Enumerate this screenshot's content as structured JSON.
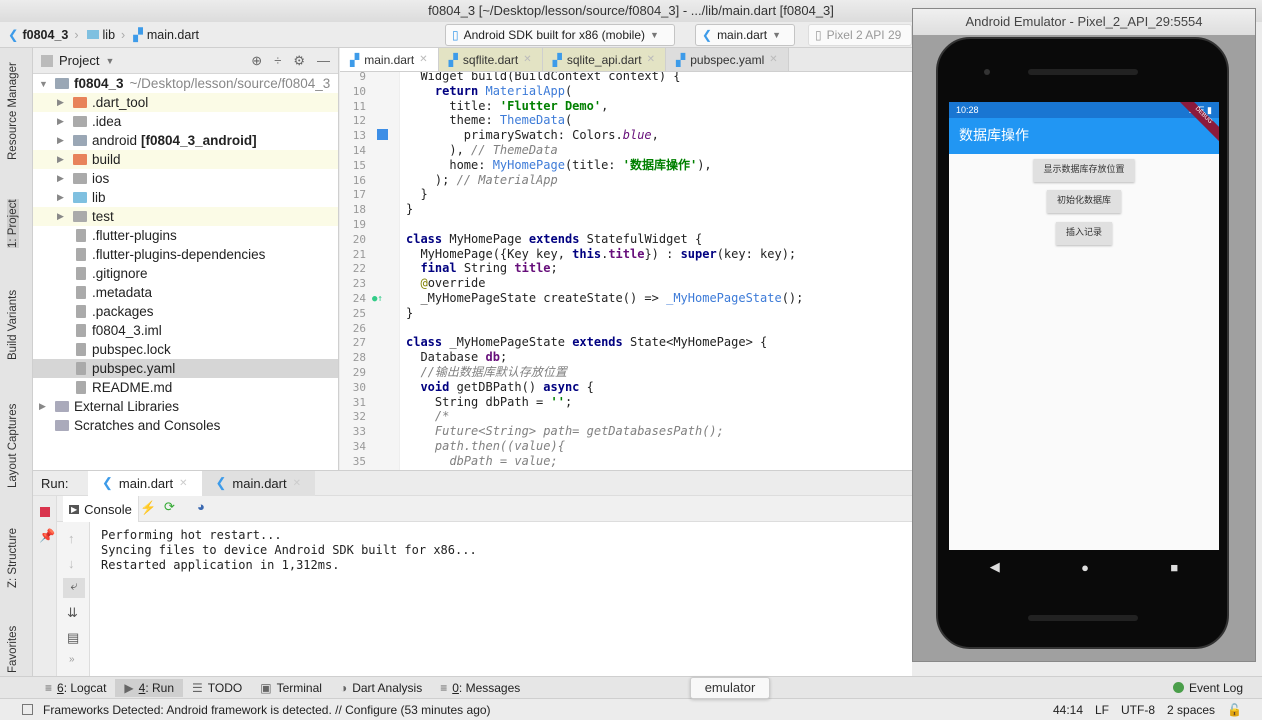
{
  "window_title": "f0804_3 [~/Desktop/lesson/source/f0804_3] - .../lib/main.dart [f0804_3]",
  "nav": {
    "breadcrumbs": [
      "f0804_3",
      "lib",
      "main.dart"
    ],
    "device_selector": "Android SDK built for x86 (mobile)",
    "run_config": "main.dart",
    "avd": "Pixel 2 API 29"
  },
  "left_stripe": [
    "Resource Manager",
    "1: Project",
    "Build Variants",
    "Layout Captures",
    "Z: Structure",
    "Favorites"
  ],
  "project": {
    "header": "Project",
    "root": "f0804_3",
    "root_path": "~/Desktop/lesson/source/f0804_3",
    "items": [
      {
        "label": ".dart_tool",
        "type": "folder",
        "color": "#e8835a"
      },
      {
        "label": ".idea",
        "type": "folder",
        "color": "#aaaaaa"
      },
      {
        "label": "android",
        "suffix": "[f0804_3_android]",
        "type": "folder",
        "color": "#9aa7b5"
      },
      {
        "label": "build",
        "type": "folder",
        "color": "#e8835a"
      },
      {
        "label": "ios",
        "type": "folder",
        "color": "#aaaaaa"
      },
      {
        "label": "lib",
        "type": "folder",
        "color": "#7fc0e0"
      },
      {
        "label": "test",
        "type": "folder",
        "color": "#aaaaaa"
      },
      {
        "label": ".flutter-plugins",
        "type": "file"
      },
      {
        "label": ".flutter-plugins-dependencies",
        "type": "file"
      },
      {
        "label": ".gitignore",
        "type": "file"
      },
      {
        "label": ".metadata",
        "type": "file"
      },
      {
        "label": ".packages",
        "type": "file"
      },
      {
        "label": "f0804_3.iml",
        "type": "file"
      },
      {
        "label": "pubspec.lock",
        "type": "file"
      },
      {
        "label": "pubspec.yaml",
        "type": "file",
        "selected": true
      },
      {
        "label": "README.md",
        "type": "file"
      }
    ],
    "external_libraries": "External Libraries",
    "scratches": "Scratches and Consoles"
  },
  "editor": {
    "tabs": [
      "main.dart",
      "sqflite.dart",
      "sqlite_api.dart",
      "pubspec.yaml"
    ],
    "active_tab": 0,
    "lines": [
      {
        "n": "9",
        "t": [
          [
            "  Widget build(BuildContext context) {",
            ""
          ]
        ]
      },
      {
        "n": "10",
        "t": [
          [
            "    ",
            ""
          ],
          [
            "return ",
            "kw"
          ],
          [
            "MaterialApp",
            "cls"
          ],
          [
            "(",
            ""
          ]
        ]
      },
      {
        "n": "11",
        "t": [
          [
            "      title: ",
            ""
          ],
          [
            "'Flutter Demo'",
            "str"
          ],
          [
            ",",
            ""
          ]
        ]
      },
      {
        "n": "12",
        "t": [
          [
            "      theme: ",
            ""
          ],
          [
            "ThemeData",
            "cls"
          ],
          [
            "(",
            ""
          ]
        ]
      },
      {
        "n": "13",
        "t": [
          [
            "        primarySwatch: Colors.",
            ""
          ],
          [
            "blue",
            "it"
          ],
          [
            ",",
            ""
          ]
        ]
      },
      {
        "n": "14",
        "t": [
          [
            "      ), ",
            ""
          ],
          [
            "// ThemeData",
            "cm"
          ]
        ]
      },
      {
        "n": "15",
        "t": [
          [
            "      home: ",
            ""
          ],
          [
            "MyHomePage",
            "cls"
          ],
          [
            "(title: ",
            ""
          ],
          [
            "'数据库操作'",
            "str"
          ],
          [
            "),",
            ""
          ]
        ]
      },
      {
        "n": "16",
        "t": [
          [
            "    ); ",
            ""
          ],
          [
            "// MaterialApp",
            "cm"
          ]
        ]
      },
      {
        "n": "17",
        "t": [
          [
            "  }",
            ""
          ]
        ]
      },
      {
        "n": "18",
        "t": [
          [
            "}",
            ""
          ]
        ]
      },
      {
        "n": "19",
        "t": [
          [
            "",
            ""
          ]
        ]
      },
      {
        "n": "20",
        "t": [
          [
            "class ",
            "kw"
          ],
          [
            "MyHomePage ",
            ""
          ],
          [
            "extends ",
            "kw"
          ],
          [
            "StatefulWidget {",
            ""
          ]
        ]
      },
      {
        "n": "21",
        "t": [
          [
            "  MyHomePage({Key key, ",
            ""
          ],
          [
            "this",
            "kw"
          ],
          [
            ".",
            ""
          ],
          [
            "title",
            "fld"
          ],
          [
            "}) : ",
            ""
          ],
          [
            "super",
            "kw"
          ],
          [
            "(key: key);",
            ""
          ]
        ]
      },
      {
        "n": "22",
        "t": [
          [
            "  ",
            ""
          ],
          [
            "final ",
            "kw"
          ],
          [
            "String ",
            ""
          ],
          [
            "title",
            "fld"
          ],
          [
            ";",
            ""
          ]
        ]
      },
      {
        "n": "23",
        "t": [
          [
            "  ",
            ""
          ],
          [
            "@",
            "ann"
          ],
          [
            "override",
            ""
          ]
        ]
      },
      {
        "n": "24",
        "t": [
          [
            "  _MyHomePageState createState() => ",
            ""
          ],
          [
            "_MyHomePageState",
            "cls"
          ],
          [
            "();",
            ""
          ]
        ]
      },
      {
        "n": "25",
        "t": [
          [
            "}",
            ""
          ]
        ]
      },
      {
        "n": "26",
        "t": [
          [
            "",
            ""
          ]
        ]
      },
      {
        "n": "27",
        "t": [
          [
            "class ",
            "kw"
          ],
          [
            "_MyHomePageState ",
            ""
          ],
          [
            "extends ",
            "kw"
          ],
          [
            "State<MyHomePage> {",
            ""
          ]
        ]
      },
      {
        "n": "28",
        "t": [
          [
            "  Database ",
            ""
          ],
          [
            "db",
            "fld"
          ],
          [
            ";",
            ""
          ]
        ]
      },
      {
        "n": "29",
        "t": [
          [
            "  //输出数据库默认存放位置",
            "cm"
          ]
        ]
      },
      {
        "n": "30",
        "t": [
          [
            "  ",
            ""
          ],
          [
            "void ",
            "kw"
          ],
          [
            "getDBPath() ",
            ""
          ],
          [
            "async ",
            "kw"
          ],
          [
            "{",
            ""
          ]
        ]
      },
      {
        "n": "31",
        "t": [
          [
            "    String dbPath = ",
            ""
          ],
          [
            "''",
            "str"
          ],
          [
            ";",
            ""
          ]
        ]
      },
      {
        "n": "32",
        "t": [
          [
            "    /*",
            "cm"
          ]
        ]
      },
      {
        "n": "33",
        "t": [
          [
            "    Future<String> path= getDatabasesPath();",
            "cm"
          ]
        ]
      },
      {
        "n": "34",
        "t": [
          [
            "    path.then((value){",
            "cm"
          ]
        ]
      },
      {
        "n": "35",
        "t": [
          [
            "      dbPath = value;",
            "cm"
          ]
        ]
      }
    ]
  },
  "run": {
    "label": "Run:",
    "tabs": [
      "main.dart",
      "main.dart"
    ],
    "console_tab": "Console",
    "output": [
      "Performing hot restart...",
      "Syncing files to device Android SDK built for x86...",
      "Restarted application in 1,312ms."
    ]
  },
  "bottom_tools": [
    {
      "num": "6",
      "label": ": Logcat"
    },
    {
      "num": "4",
      "label": ": Run",
      "active": true
    },
    {
      "num": "",
      "label": "TODO"
    },
    {
      "num": "",
      "label": "Terminal"
    },
    {
      "num": "",
      "label": "Dart Analysis"
    },
    {
      "num": "0",
      "label": ": Messages"
    }
  ],
  "event_log": "Event Log",
  "tooltip": "emulator",
  "status": {
    "message": "Frameworks Detected: Android framework is detected. // Configure (53 minutes ago)",
    "position": "44:14",
    "line_sep": "LF",
    "encoding": "UTF-8",
    "indent": "2 spaces"
  },
  "emulator": {
    "title": "Android Emulator - Pixel_2_API_29:5554",
    "time": "10:28",
    "network": "LTE",
    "debug_banner": "DEBUG",
    "app_title": "数据库操作",
    "buttons": [
      "显示数据库存放位置",
      "初始化数据库",
      "插入记录"
    ],
    "colors": {
      "status_bar": "#1976d2",
      "app_bar": "#2196f3"
    }
  }
}
